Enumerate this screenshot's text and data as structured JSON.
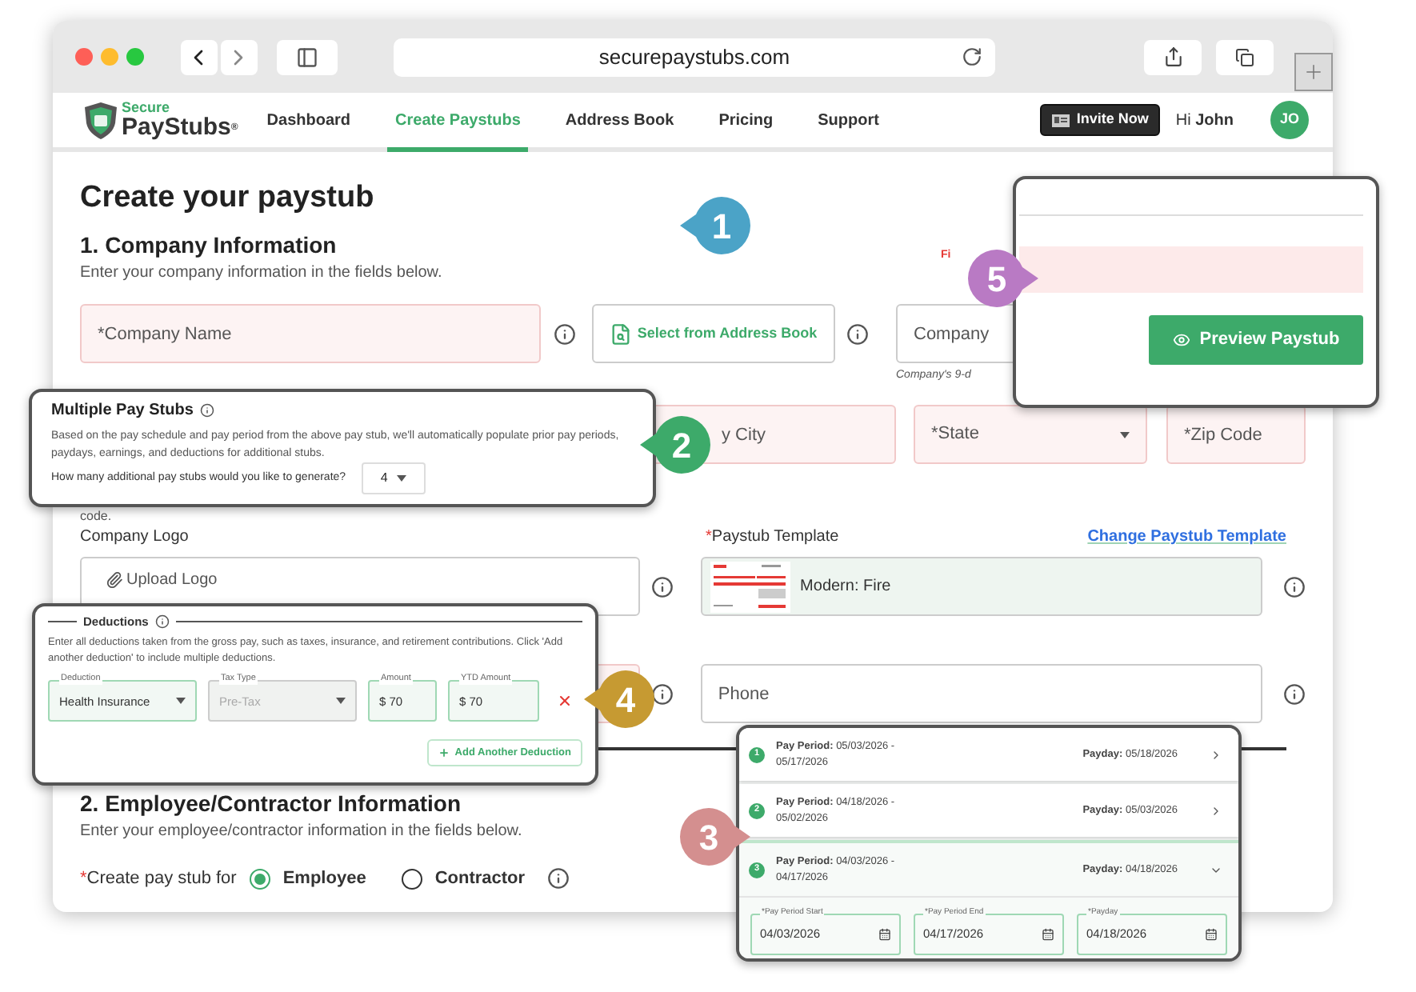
{
  "browser": {
    "url": "securepaystubs.com"
  },
  "nav": {
    "logo_top": "Secure",
    "logo_main": "PayStubs",
    "logo_mark": "®",
    "links": [
      {
        "label": "Dashboard",
        "selected": false
      },
      {
        "label": "Create Paystubs",
        "selected": true
      },
      {
        "label": "Address Book",
        "selected": false
      },
      {
        "label": "Pricing",
        "selected": false
      },
      {
        "label": "Support",
        "selected": false
      }
    ],
    "invite_button": "Invite Now",
    "greeting": "Hi **John**",
    "avatar": "JO"
  },
  "page": {
    "title": "Create your paystub",
    "company_section": {
      "heading": "1. Company Information",
      "subtitle": "Enter your company information in the fields below.",
      "company_name": {
        "placeholder": "*Company Name"
      },
      "address_book_button": "Select from Address Book",
      "company_id": {
        "placeholder": "Company"
      },
      "company_id_helper": "Company's 9-d",
      "error_text": "Fi",
      "city": {
        "placeholder": "y City"
      },
      "state": {
        "placeholder": "*State"
      },
      "zip": {
        "placeholder": "*Zip Code"
      },
      "note_tail": "code.",
      "logo_label": "Company Logo",
      "upload_label": "Upload Logo",
      "template_required_mark": "*",
      "template_label": "Paystub Template",
      "change_template_link": "Change Paystub Template",
      "template_name": "Modern: Fire",
      "phone": {
        "placeholder": "Phone"
      }
    },
    "employee_section": {
      "heading": "2. Employee/Contractor Information",
      "subtitle": "Enter your employee/contractor information in the fields below.",
      "required_mark": "*",
      "worker_type_label": "Create pay stub for",
      "options": [
        {
          "label": "Employee",
          "selected": true
        },
        {
          "label": "Contractor",
          "selected": false
        }
      ]
    }
  },
  "callouts": [
    {
      "number": "1",
      "color": "#4ba3c7",
      "kind": "left"
    },
    {
      "number": "2",
      "color": "#3daa6a",
      "kind": "left"
    },
    {
      "number": "3",
      "color": "#d48f8f",
      "kind": "right"
    },
    {
      "number": "4",
      "color": "#c69a32",
      "kind": "left"
    },
    {
      "number": "5",
      "color": "#b97ac4",
      "kind": "right"
    }
  ],
  "multiple_pay_stubs": {
    "title": "Multiple Pay Stubs",
    "description": "Based on the pay schedule and pay period from the above pay stub, we'll automatically populate prior pay periods, paydays, earnings, and deductions for additional stubs.",
    "question": "How many additional pay stubs would you like to generate?",
    "count": "4"
  },
  "deductions": {
    "title": "Deductions",
    "description": "Enter all deductions taken from the gross pay, such as taxes, insurance, and retirement contributions. Click 'Add another deduction' to include multiple deductions.",
    "fields": [
      {
        "kind": "select",
        "label": "Deduction",
        "value": "Health Insurance",
        "disabled": false
      },
      {
        "kind": "select",
        "label": "Tax Type",
        "value": "Pre-Tax",
        "disabled": true
      },
      {
        "kind": "money",
        "label": "Amount",
        "prefix": "$",
        "value": "70",
        "disabled": false
      },
      {
        "kind": "money",
        "label": "YTD Amount",
        "prefix": "$",
        "value": "70",
        "disabled": false
      }
    ],
    "add_button": "Add Another Deduction"
  },
  "pay_periods": {
    "items": [
      {
        "number": "1",
        "period": "**Pay Period:** 05/03/2026 - 05/17/2026",
        "payday": "**Payday:** 05/18/2026",
        "expanded": false
      },
      {
        "number": "2",
        "period": "**Pay Period:** 04/18/2026 - 05/02/2026",
        "payday": "**Payday:** 05/03/2026",
        "expanded": false
      },
      {
        "number": "3",
        "period": "**Pay Period:** 04/03/2026 - 04/17/2026",
        "payday": "**Payday:** 04/18/2026",
        "expanded": true
      }
    ],
    "date_fields": [
      {
        "label": "*Pay Period Start",
        "value": "04/03/2026"
      },
      {
        "label": "*Pay Period End",
        "value": "04/17/2026"
      },
      {
        "label": "*Payday",
        "value": "04/18/2026"
      }
    ]
  },
  "preview": {
    "button": "Preview Paystub"
  }
}
